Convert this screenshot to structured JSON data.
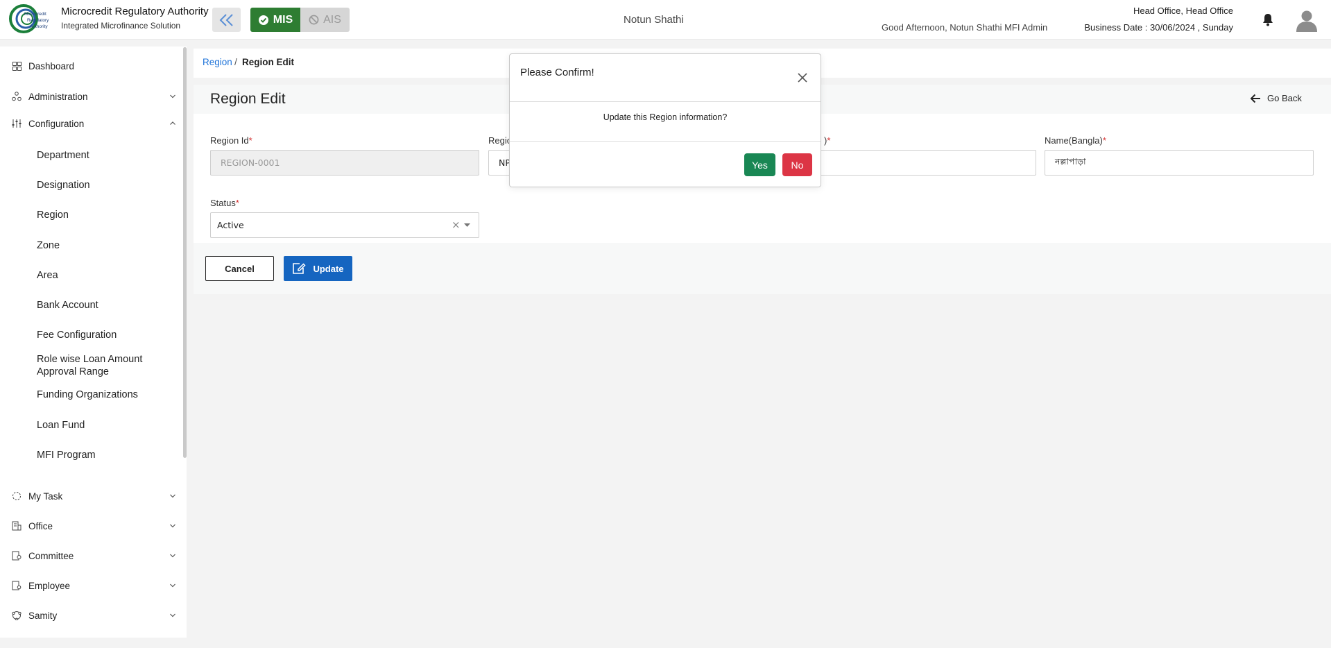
{
  "header": {
    "logo_text": "Microcredit Regulatory Authority",
    "brand_title": "Microcredit Regulatory Authority",
    "brand_subtitle": "Integrated Microfinance Solution",
    "mode_mis": "MIS",
    "mode_ais": "AIS",
    "org_name": "Notun Shathi",
    "greeting": "Good Afternoon, Notun Shathi MFI Admin",
    "office": "Head Office, Head Office",
    "business_date": "Business Date : 30/06/2024 , Sunday"
  },
  "sidebar": {
    "items": [
      {
        "label": "Dashboard",
        "icon": "dashboard-icon"
      },
      {
        "label": "Administration",
        "icon": "administration-icon"
      },
      {
        "label": "Configuration",
        "icon": "configuration-icon"
      },
      {
        "label": "My Task",
        "icon": "task-icon"
      },
      {
        "label": "Office",
        "icon": "office-icon"
      },
      {
        "label": "Committee",
        "icon": "committee-icon"
      },
      {
        "label": "Employee",
        "icon": "employee-icon"
      },
      {
        "label": "Samity",
        "icon": "samity-icon"
      }
    ],
    "config_items": [
      "Department",
      "Designation",
      "Region",
      "Zone",
      "Area",
      "Bank Account",
      "Fee Configuration",
      "Role wise Loan Amount Approval Range",
      "Funding Organizations",
      "Loan Fund",
      "MFI Program"
    ]
  },
  "breadcrumb": {
    "parent": "Region",
    "separator": "/",
    "current": "Region Edit"
  },
  "page": {
    "title": "Region Edit",
    "go_back": "Go Back"
  },
  "form": {
    "region_id_label": "Region Id",
    "region_id_value": "REGION-0001",
    "region_code_label_visible": "Regio",
    "region_code_value_visible": "NP",
    "name_en_label_visible": ")",
    "name_bn_label": "Name(Bangla)",
    "name_bn_value": "নল্লাপাড়া",
    "required_mark": "*",
    "status_label": "Status",
    "status_value": "Active",
    "clear_symbol": "×"
  },
  "actions": {
    "cancel": "Cancel",
    "update": "Update"
  },
  "modal": {
    "title": "Please Confirm!",
    "message": "Update this Region information?",
    "yes": "Yes",
    "no": "No"
  },
  "colors": {
    "primary": "#1565c0",
    "mis_green": "#2e7d32",
    "yes_green": "#198754",
    "no_red": "#dc3545",
    "link_blue": "#1e73d9"
  }
}
